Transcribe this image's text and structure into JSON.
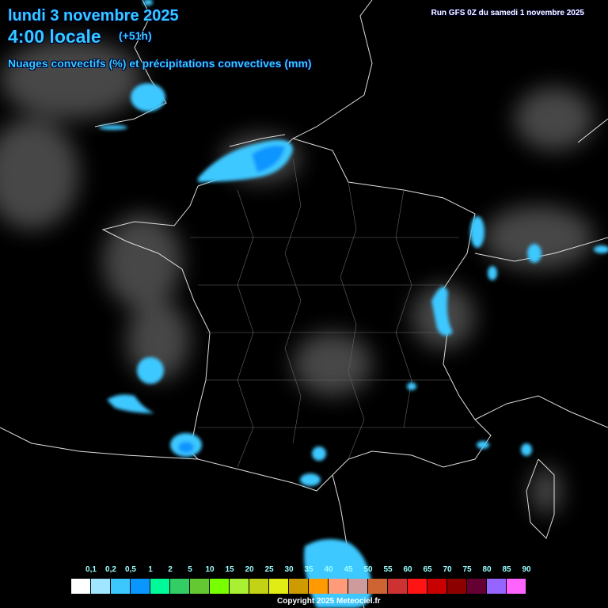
{
  "header": {
    "date": "lundi 3 novembre 2025",
    "time": "4:00 locale",
    "lead": "(+51h)",
    "title": "Nuages convectifs (%) et précipitations convectives (mm)",
    "run": "Run GFS 0Z du samedi 1 novembre 2025"
  },
  "legend": {
    "labels": [
      "0,1",
      "0,2",
      "0,5",
      "1",
      "2",
      "5",
      "10",
      "15",
      "20",
      "25",
      "30",
      "35",
      "40",
      "45",
      "50",
      "55",
      "60",
      "65",
      "70",
      "75",
      "80",
      "85",
      "90"
    ],
    "colors": [
      "#ffffff",
      "#a0e6ff",
      "#3cc8ff",
      "#0a96ff",
      "#00fa9a",
      "#32cd64",
      "#64c832",
      "#78ff00",
      "#aaf032",
      "#c3d214",
      "#e1eb14",
      "#cd9b00",
      "#ff9b00",
      "#ff9b78",
      "#cd9b9b",
      "#cd6432",
      "#cd3232",
      "#ff1414",
      "#c80000",
      "#8c0000",
      "#640032",
      "#9664ff",
      "#ff64ff"
    ]
  },
  "footer": {
    "copyright": "Copyright 2025 Meteociel.fr"
  }
}
